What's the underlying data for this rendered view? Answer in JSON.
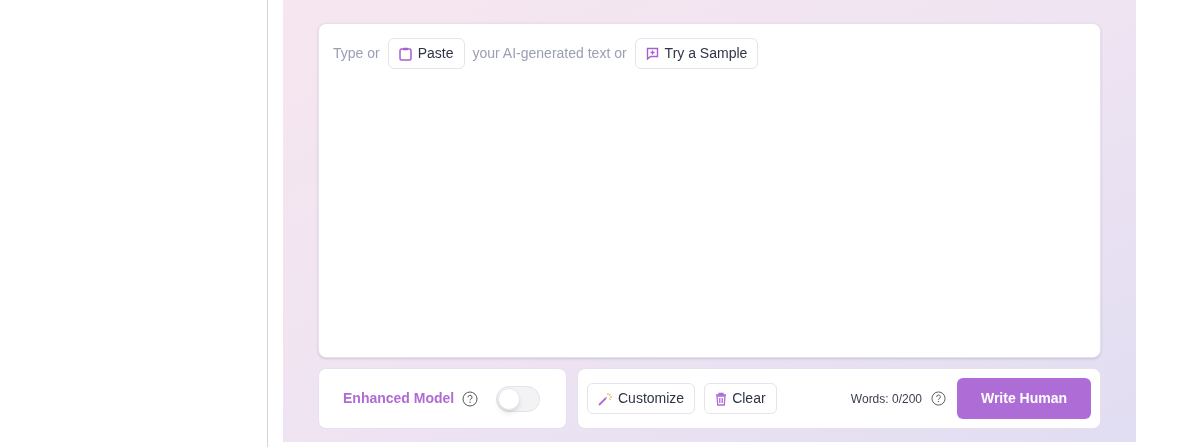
{
  "editor": {
    "prompt_start": "Type or",
    "paste_button": "Paste",
    "prompt_middle": "your AI-generated text or",
    "sample_button": "Try a Sample"
  },
  "model_panel": {
    "label": "Enhanced Model",
    "toggle_on": false
  },
  "actions": {
    "customize_button": "Customize",
    "clear_button": "Clear",
    "word_count": "Words: 0/200",
    "submit_button": "Write Human"
  }
}
